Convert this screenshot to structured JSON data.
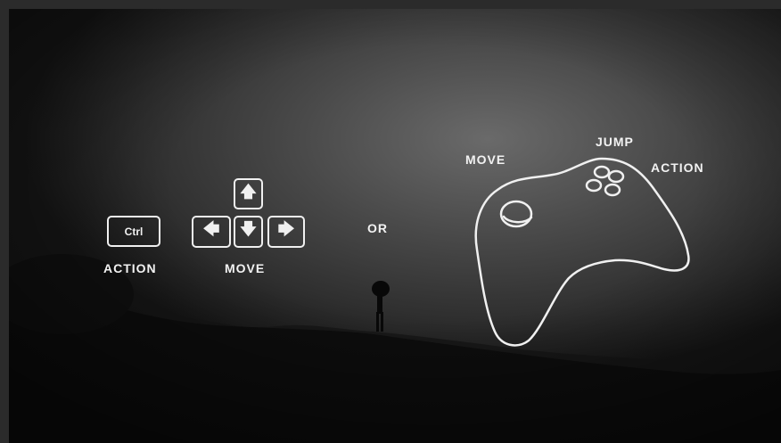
{
  "keyboard": {
    "ctrl_key": "Ctrl",
    "action_label": "ACTION",
    "move_label": "MOVE",
    "up_key": "🡅",
    "left_key": "🡄",
    "down_key": "🡇",
    "right_key": "🡆"
  },
  "separator": "OR",
  "gamepad": {
    "move_label": "MOVE",
    "jump_label": "JUMP",
    "action_label": "ACTION"
  },
  "colors": {
    "chalk": "#f0f0f0",
    "background": "#4a4a4a"
  },
  "icons": {
    "up": "arrow-up-icon",
    "down": "arrow-down-icon",
    "left": "arrow-left-icon",
    "right": "arrow-right-icon",
    "controller": "gamepad-icon"
  }
}
